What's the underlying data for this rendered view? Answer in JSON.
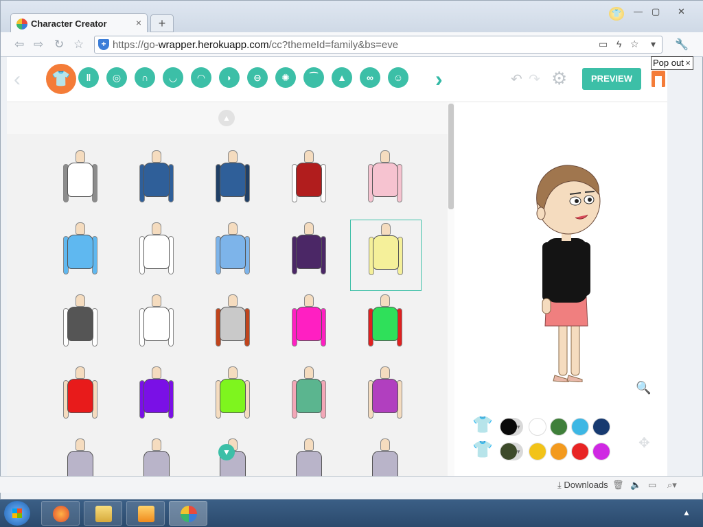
{
  "browser": {
    "tab_title": "Character Creator",
    "tab_close": "×",
    "new_tab": "+",
    "url_prefix": "https://go-",
    "url_host": "wrapper.herokuapp.com",
    "url_path": "/cc?themeId=family&bs=eve"
  },
  "toolbar": {
    "preview_label": "PREVIEW",
    "popout_label": "Pop out",
    "popout_close": "×"
  },
  "categories": [
    {
      "name": "tops",
      "glyph": "👕"
    },
    {
      "name": "bottoms",
      "glyph": "‖"
    },
    {
      "name": "face-shape",
      "glyph": "◎"
    },
    {
      "name": "hair",
      "glyph": "∩"
    },
    {
      "name": "beard",
      "glyph": "◡"
    },
    {
      "name": "mouth",
      "glyph": "◠"
    },
    {
      "name": "ears",
      "glyph": "◗"
    },
    {
      "name": "head",
      "glyph": "⊖"
    },
    {
      "name": "eyes",
      "glyph": "✺"
    },
    {
      "name": "eyebrows",
      "glyph": "⁀"
    },
    {
      "name": "nose",
      "glyph": "▲"
    },
    {
      "name": "glasses",
      "glyph": "∞"
    },
    {
      "name": "face-marks",
      "glyph": "☺"
    }
  ],
  "gallery_items": [
    {
      "torso": "#ffffff",
      "accent": "#8c8c8c"
    },
    {
      "torso": "#2f5f99",
      "accent": "#2f5f99"
    },
    {
      "torso": "#2f5f99",
      "accent": "#1f3f66"
    },
    {
      "torso": "#b11d1d",
      "accent": "#ffffff"
    },
    {
      "torso": "#f6c3d0",
      "accent": "#f6c3d0"
    },
    {
      "torso": "#5fb8f0",
      "accent": "#5fb8f0"
    },
    {
      "torso": "#ffffff",
      "accent": "#ffffff"
    },
    {
      "torso": "#7db4ea",
      "accent": "#7db4ea"
    },
    {
      "torso": "#4b2766",
      "accent": "#4b2766"
    },
    {
      "torso": "#f5f09a",
      "accent": "#f5f09a"
    },
    {
      "torso": "#555555",
      "accent": "#ffffff"
    },
    {
      "torso": "#ffffff",
      "accent": "#ffffff"
    },
    {
      "torso": "#c9c9c9",
      "accent": "#c0441c"
    },
    {
      "torso": "#ff1fc2",
      "accent": "#ff1fc2"
    },
    {
      "torso": "#2fe05a",
      "accent": "#e02020"
    },
    {
      "torso": "#e81b1b",
      "accent": "#f5dcbf"
    },
    {
      "torso": "#7a10e6",
      "accent": "#7a10e6"
    },
    {
      "torso": "#7ef51e",
      "accent": "#f5dcbf"
    },
    {
      "torso": "#5bb58f",
      "accent": "#f3a7b7"
    },
    {
      "torso": "#b13fbf",
      "accent": "#f5dcbf"
    }
  ],
  "swatches": {
    "row1": [
      "#0a0a0a",
      "#ffffff",
      "#3f7f3a",
      "#3db7e4",
      "#173a70"
    ],
    "row2": [
      "#3d4a2a",
      "#f2c318",
      "#f39a1e",
      "#e82424",
      "#cf28e3"
    ]
  },
  "status": {
    "downloads": "Downloads"
  }
}
